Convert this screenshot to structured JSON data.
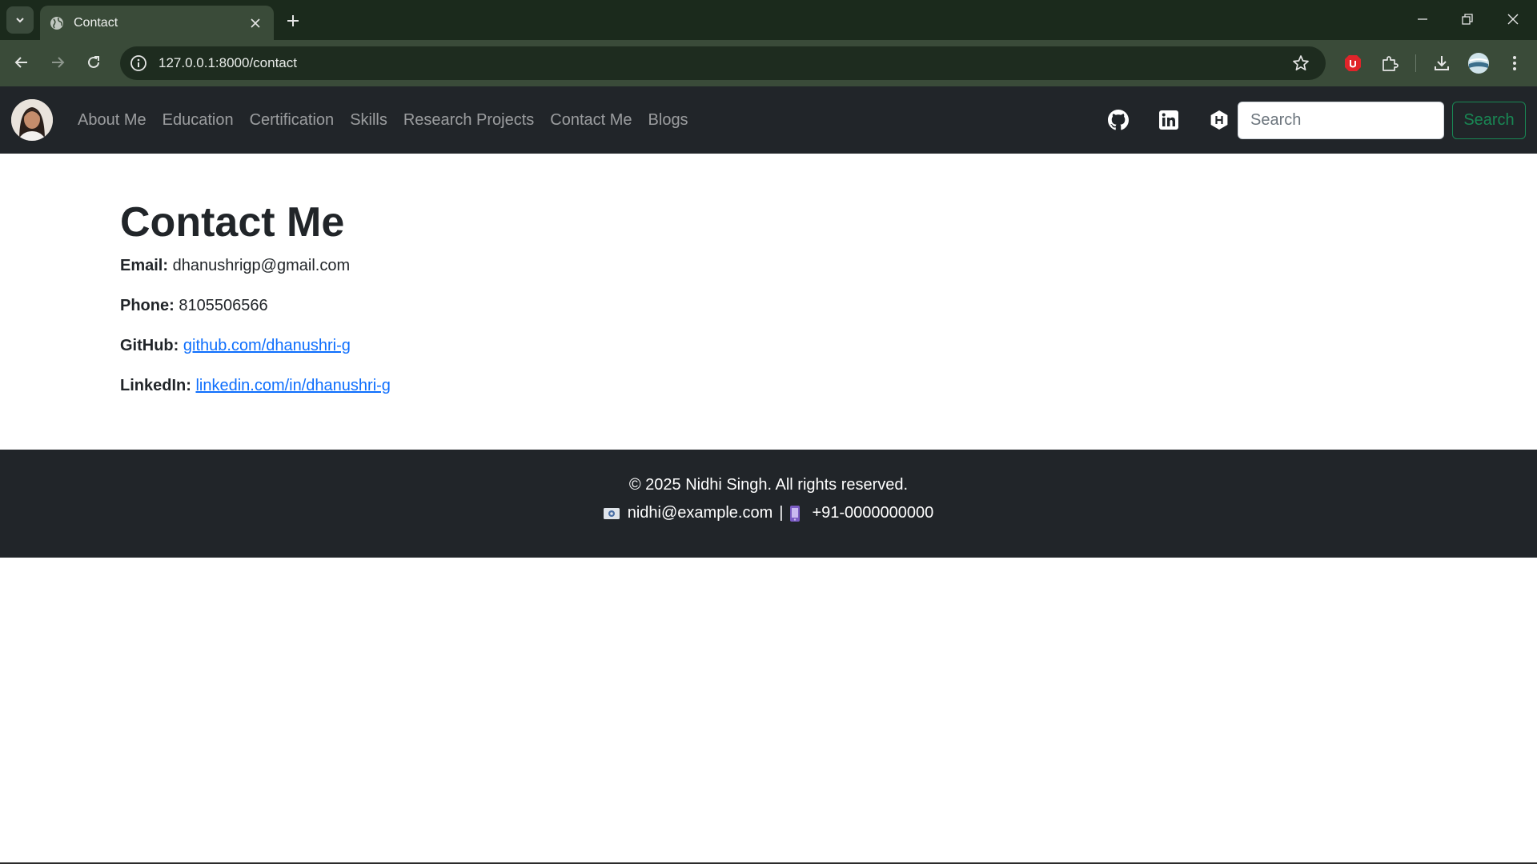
{
  "browser": {
    "tab_title": "Contact",
    "url": "127.0.0.1:8000/contact"
  },
  "navbar": {
    "links": [
      "About Me",
      "Education",
      "Certification",
      "Skills",
      "Research Projects",
      "Contact Me",
      "Blogs"
    ],
    "search_placeholder": "Search",
    "search_button": "Search",
    "social_icons": [
      "github-icon",
      "linkedin-icon",
      "hashnode-icon"
    ]
  },
  "contact": {
    "heading": "Contact Me",
    "email_label": "Email:",
    "email_value": "dhanushrigp@gmail.com",
    "phone_label": "Phone:",
    "phone_value": "8105506566",
    "github_label": "GitHub:",
    "github_link": "github.com/dhanushri-g",
    "linkedin_label": "LinkedIn:",
    "linkedin_link": "linkedin.com/in/dhanushri-g"
  },
  "footer": {
    "copyright": "© 2025 Nidhi Singh. All rights reserved.",
    "email": "nidhi@example.com",
    "separator": "|",
    "phone": "+91-0000000000"
  },
  "colors": {
    "browser_frame": "#1b2a1c",
    "toolbar": "#3a4b39",
    "navbar": "#212529",
    "link": "#0d6efd",
    "search_button": "#198754"
  }
}
